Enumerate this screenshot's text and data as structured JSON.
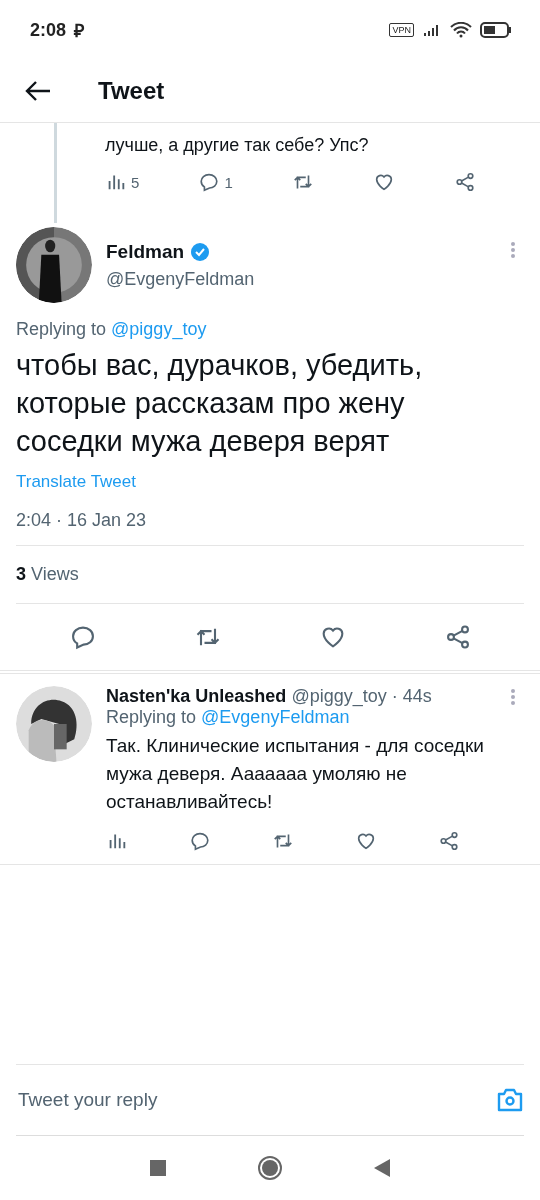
{
  "status_bar": {
    "time": "2:08",
    "app_glyph": "₽",
    "vpn": "VPN"
  },
  "header": {
    "title": "Tweet"
  },
  "parent_tweet": {
    "text_tail": "лучше, а другие так себе? Упс?",
    "actions": [
      {
        "kind": "views",
        "count": "5"
      },
      {
        "kind": "reply",
        "count": "1"
      },
      {
        "kind": "retweet"
      },
      {
        "kind": "like"
      },
      {
        "kind": "share"
      }
    ]
  },
  "main_tweet": {
    "name": "Feldman",
    "verified": true,
    "handle": "@EvgenyFeldman",
    "replying_label": "Replying to",
    "replying_to": "@piggy_toy",
    "text": "чтобы вас, дурачков, убедить, которые рассказам про жену соседки мужа деверя верят",
    "translate": "Translate Tweet",
    "timestamp": "2:04 · 16 Jan 23",
    "views_count": "3",
    "views_label": "Views",
    "actions": [
      {
        "kind": "reply"
      },
      {
        "kind": "retweet"
      },
      {
        "kind": "like"
      },
      {
        "kind": "share"
      }
    ]
  },
  "replies": [
    {
      "name": "Nasten'ka Unleashed",
      "handle": "@piggy_toy · 44s",
      "replying_label": "Replying to",
      "replying_to": "@EvgenyFeldman",
      "text": "Так. Клинические испытания - для соседки мужа деверя. Ааааааа умоляю не останавливайтесь!",
      "actions": [
        {
          "kind": "views"
        },
        {
          "kind": "reply"
        },
        {
          "kind": "retweet"
        },
        {
          "kind": "like"
        },
        {
          "kind": "share"
        }
      ]
    }
  ],
  "composer": {
    "placeholder": "Tweet your reply"
  }
}
